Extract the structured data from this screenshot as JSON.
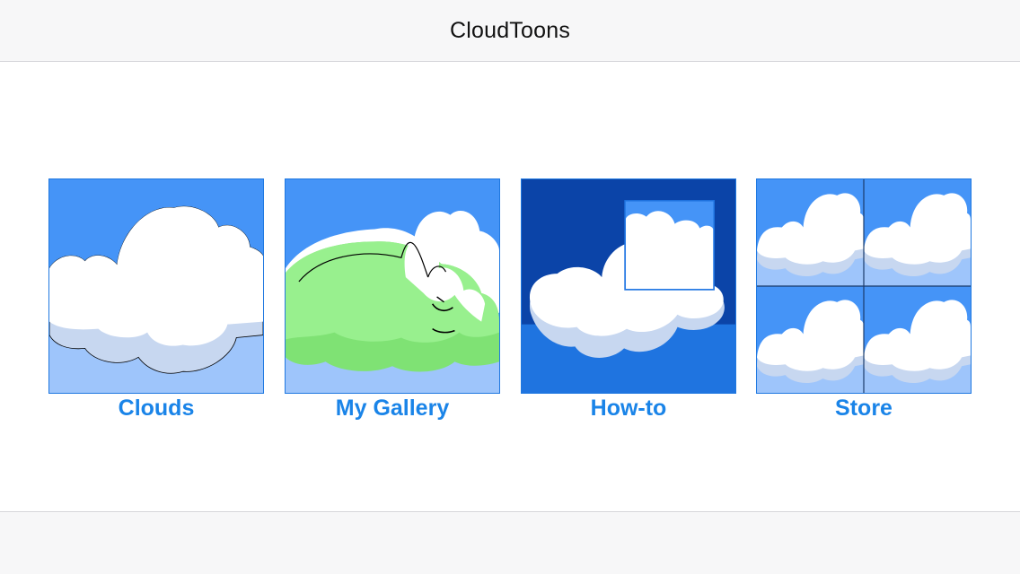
{
  "navbar": {
    "title": "CloudToons"
  },
  "tiles": [
    {
      "label": "Clouds",
      "icon": "cloud-icon"
    },
    {
      "label": "My Gallery",
      "icon": "green-cloud-character-icon"
    },
    {
      "label": "How-to",
      "icon": "cloud-crop-icon"
    },
    {
      "label": "Store",
      "icon": "cloud-grid-icon"
    }
  ],
  "colors": {
    "accent": "#1a84e8",
    "sky": "#4594f7",
    "sky_light": "#9ec5fb",
    "sky_dark": "#0b44a8",
    "cloud_shadow": "#c7d7f0",
    "green": "#98f08e",
    "bar_bg": "#f7f7f8"
  }
}
